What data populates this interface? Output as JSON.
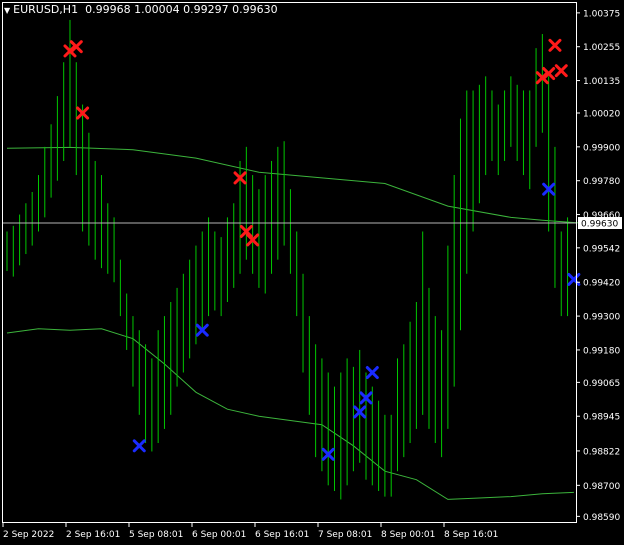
{
  "header": {
    "symbol": "EURUSD,H1",
    "open": "0.99968",
    "high": "1.00004",
    "low": "0.99297",
    "close": "0.99630",
    "triangle": "▼"
  },
  "colors": {
    "background": "#000000",
    "candles": "#00c800",
    "ma_lines": "#3cb43c",
    "frame": "#ffffff",
    "sell_marker": "#ff1a1a",
    "buy_marker": "#1a2bff",
    "price_line": "#b4b4b4"
  },
  "chart_data": {
    "type": "line",
    "title": "EURUSD,H1",
    "ylim": [
      0.9857,
      1.0041
    ],
    "y_ticks": [
      "1.00375",
      "1.00255",
      "1.00135",
      "1.00020",
      "0.99900",
      "0.99780",
      "0.99660",
      "0.99542",
      "0.99420",
      "0.99300",
      "0.99180",
      "0.99065",
      "0.98945",
      "0.98822",
      "0.98700",
      "0.98590"
    ],
    "current_price": "0.99630",
    "x_ticks": [
      "2 Sep 2022",
      "2 Sep 16:01",
      "5 Sep 08:01",
      "6 Sep 00:01",
      "6 Sep 16:01",
      "7 Sep 08:01",
      "8 Sep 00:01",
      "8 Sep 16:01"
    ],
    "bar_ranges": [
      [
        0.9946,
        0.996
      ],
      [
        0.9944,
        0.9962
      ],
      [
        0.9948,
        0.9966
      ],
      [
        0.9952,
        0.997
      ],
      [
        0.9955,
        0.9974
      ],
      [
        0.996,
        0.998
      ],
      [
        0.9965,
        0.999
      ],
      [
        0.9972,
        0.9998
      ],
      [
        0.9978,
        1.0008
      ],
      [
        0.9985,
        1.002
      ],
      [
        0.999,
        1.0035
      ],
      [
        0.998,
        1.002
      ],
      [
        0.996,
        1.0005
      ],
      [
        0.9955,
        0.9995
      ],
      [
        0.995,
        0.9985
      ],
      [
        0.9947,
        0.998
      ],
      [
        0.9945,
        0.997
      ],
      [
        0.9942,
        0.9965
      ],
      [
        0.993,
        0.995
      ],
      [
        0.9918,
        0.9938
      ],
      [
        0.9905,
        0.993
      ],
      [
        0.9895,
        0.9925
      ],
      [
        0.9885,
        0.992
      ],
      [
        0.9882,
        0.9915
      ],
      [
        0.9885,
        0.9925
      ],
      [
        0.989,
        0.993
      ],
      [
        0.9895,
        0.9935
      ],
      [
        0.9905,
        0.994
      ],
      [
        0.991,
        0.9945
      ],
      [
        0.9915,
        0.995
      ],
      [
        0.992,
        0.9955
      ],
      [
        0.9925,
        0.996
      ],
      [
        0.993,
        0.9965
      ],
      [
        0.9932,
        0.996
      ],
      [
        0.993,
        0.9958
      ],
      [
        0.9935,
        0.9965
      ],
      [
        0.994,
        0.997
      ],
      [
        0.9945,
        0.9985
      ],
      [
        0.995,
        0.999
      ],
      [
        0.9945,
        0.998
      ],
      [
        0.994,
        0.9975
      ],
      [
        0.9938,
        0.998
      ],
      [
        0.9945,
        0.9985
      ],
      [
        0.995,
        0.999
      ],
      [
        0.9955,
        0.9992
      ],
      [
        0.9945,
        0.9975
      ],
      [
        0.993,
        0.996
      ],
      [
        0.991,
        0.9945
      ],
      [
        0.9895,
        0.993
      ],
      [
        0.988,
        0.992
      ],
      [
        0.9875,
        0.9915
      ],
      [
        0.987,
        0.991
      ],
      [
        0.9868,
        0.9905
      ],
      [
        0.9865,
        0.991
      ],
      [
        0.987,
        0.9915
      ],
      [
        0.9875,
        0.9912
      ],
      [
        0.9878,
        0.9918
      ],
      [
        0.9872,
        0.991
      ],
      [
        0.987,
        0.9905
      ],
      [
        0.9868,
        0.99
      ],
      [
        0.9866,
        0.9895
      ],
      [
        0.9866,
        0.9895
      ],
      [
        0.9875,
        0.9915
      ],
      [
        0.988,
        0.992
      ],
      [
        0.9885,
        0.9928
      ],
      [
        0.989,
        0.9935
      ],
      [
        0.9895,
        0.996
      ],
      [
        0.989,
        0.994
      ],
      [
        0.9885,
        0.993
      ],
      [
        0.988,
        0.9925
      ],
      [
        0.989,
        0.9955
      ],
      [
        0.9905,
        0.998
      ],
      [
        0.9925,
        1.0
      ],
      [
        0.9945,
        1.001
      ],
      [
        0.996,
        1.001
      ],
      [
        0.997,
        1.0012
      ],
      [
        0.998,
        1.0015
      ],
      [
        0.9985,
        1.001
      ],
      [
        0.998,
        1.0005
      ],
      [
        0.9985,
        1.001
      ],
      [
        0.999,
        1.0015
      ],
      [
        0.9985,
        1.0012
      ],
      [
        0.998,
        1.001
      ],
      [
        0.9975,
        1.001
      ],
      [
        0.999,
        1.0025
      ],
      [
        0.9995,
        1.003
      ],
      [
        0.996,
        1.0015
      ],
      [
        0.994,
        0.999
      ],
      [
        0.993,
        0.996
      ],
      [
        0.993,
        0.9965
      ]
    ],
    "series": [
      {
        "name": "",
        "x": [
          0,
          10,
          20,
          30,
          40,
          50,
          60,
          70,
          80,
          85,
          91
        ],
        "values": [
          0.99895,
          0.99898,
          0.9989,
          0.9986,
          0.9981,
          0.9979,
          0.9977,
          0.9969,
          0.9965,
          0.9964,
          0.9963
        ]
      },
      {
        "name": "",
        "x": [
          0,
          5,
          10,
          15,
          20,
          25,
          30,
          35,
          40,
          45,
          50,
          55,
          60,
          65,
          70,
          75,
          80,
          85,
          90
        ],
        "values": [
          0.9924,
          0.99255,
          0.9925,
          0.99255,
          0.9922,
          0.9913,
          0.9903,
          0.9897,
          0.98945,
          0.9893,
          0.98915,
          0.9884,
          0.9875,
          0.9872,
          0.9865,
          0.98655,
          0.9866,
          0.9867,
          0.98675
        ]
      }
    ],
    "sell_markers": [
      [
        10,
        1.0024
      ],
      [
        11,
        1.00255
      ],
      [
        12,
        1.0002
      ],
      [
        37,
        0.9979
      ],
      [
        38,
        0.996
      ],
      [
        39,
        0.9957
      ],
      [
        85,
        1.00145
      ],
      [
        86,
        1.0016
      ],
      [
        87,
        1.0026
      ],
      [
        88,
        1.0017
      ]
    ],
    "buy_markers": [
      [
        21,
        0.9884
      ],
      [
        31,
        0.9925
      ],
      [
        51,
        0.9881
      ],
      [
        56,
        0.9896
      ],
      [
        57,
        0.9901
      ],
      [
        58,
        0.991
      ],
      [
        86,
        0.9975
      ],
      [
        90,
        0.9943
      ]
    ]
  }
}
